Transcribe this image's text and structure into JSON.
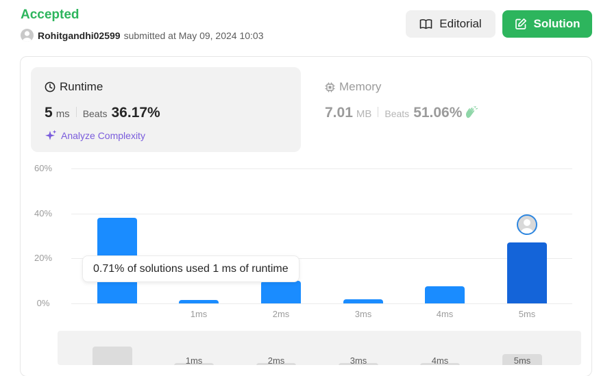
{
  "header": {
    "status": "Accepted",
    "username": "Rohitgandhi02599",
    "submitted_text": "submitted at May 09, 2024 10:03",
    "editorial_label": "Editorial",
    "solution_label": "Solution"
  },
  "runtime": {
    "title": "Runtime",
    "value": "5",
    "unit": "ms",
    "beats_label": "Beats",
    "beats_pct": "36.17%",
    "analyze_label": "Analyze Complexity"
  },
  "memory": {
    "title": "Memory",
    "value": "7.01",
    "unit": "MB",
    "beats_label": "Beats",
    "beats_pct": "51.06%"
  },
  "tooltip": {
    "text": "0.71% of solutions used 1 ms of runtime"
  },
  "colors": {
    "accepted": "#2db55d",
    "bar": "#1a8cff",
    "bar_selected": "#1464d9",
    "analyze": "#7a5cdc"
  },
  "chart_data": {
    "type": "bar",
    "categories": [
      "",
      "1ms",
      "2ms",
      "3ms",
      "4ms",
      "5ms"
    ],
    "values": [
      38,
      1.5,
      10,
      1.8,
      7.5,
      27
    ],
    "yticks": [
      "0%",
      "20%",
      "40%",
      "60%"
    ],
    "ylim": [
      0,
      60
    ],
    "highlight_index": 5,
    "grid": true,
    "overview_labels": [
      "",
      "1ms",
      "2ms",
      "3ms",
      "4ms",
      "5ms"
    ]
  }
}
